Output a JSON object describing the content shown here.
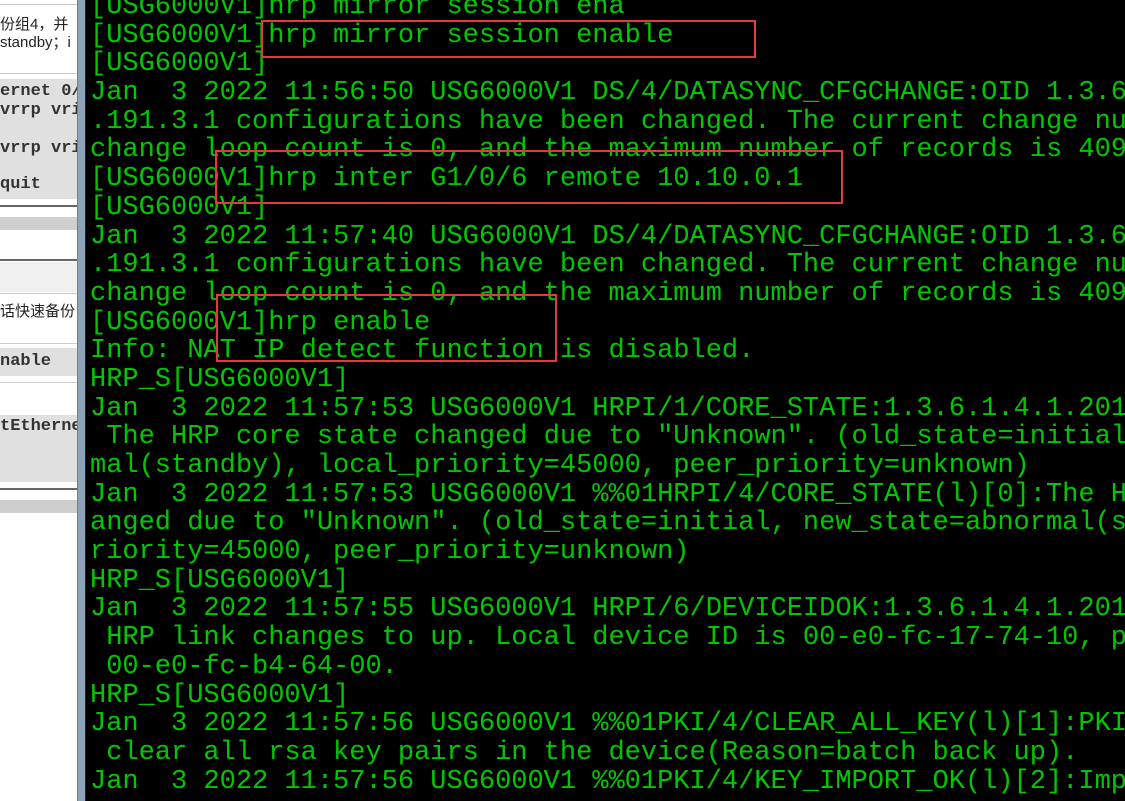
{
  "left_panel": {
    "text_lines": [
      "份组4，并",
      "standby；i",
      "话快速备份"
    ],
    "code_lines": [
      "ernet 0/",
      "vrrp vri",
      "vrrp vri",
      "quit",
      "nable",
      "tEtherne"
    ]
  },
  "terminal": {
    "text_color": "#00c800",
    "highlight_color": "#e8383d",
    "lines": [
      "[USG6000V1]hrp mirror session ena",
      "[USG6000V1]hrp mirror session enable",
      "[USG6000V1]",
      "Jan  3 2022 11:56:50 USG6000V1 DS/4/DATASYNC_CFGCHANGE:OID 1.3.6",
      ".191.3.1 configurations have been changed. The current change nu",
      "change loop count is 0, and the maximum number of records is 409",
      "[USG6000V1]hrp inter G1/0/6 remote 10.10.0.1",
      "[USG6000V1]",
      "Jan  3 2022 11:57:40 USG6000V1 DS/4/DATASYNC_CFGCHANGE:OID 1.3.6",
      ".191.3.1 configurations have been changed. The current change nu",
      "change loop count is 0, and the maximum number of records is 409",
      "[USG6000V1]hrp enable",
      "Info: NAT IP detect function is disabled.",
      "HRP_S[USG6000V1]",
      "Jan  3 2022 11:57:53 USG6000V1 HRPI/1/CORE_STATE:1.3.6.1.4.1.201",
      " The HRP core state changed due to \"Unknown\". (old_state=initial",
      "mal(standby), local_priority=45000, peer_priority=unknown)",
      "Jan  3 2022 11:57:53 USG6000V1 %%01HRPI/4/CORE_STATE(l)[0]:The H",
      "anged due to \"Unknown\". (old_state=initial, new_state=abnormal(s",
      "riority=45000, peer_priority=unknown)",
      "HRP_S[USG6000V1]",
      "Jan  3 2022 11:57:55 USG6000V1 HRPI/6/DEVICEIDOK:1.3.6.1.4.1.201",
      " HRP link changes to up. Local device ID is 00-e0-fc-17-74-10, p",
      " 00-e0-fc-b4-64-00.",
      "HRP_S[USG6000V1]",
      "Jan  3 2022 11:57:56 USG6000V1 %%01PKI/4/CLEAR_ALL_KEY(l)[1]:PKI",
      " clear all rsa key pairs in the device(Reason=batch back up).",
      "Jan  3 2022 11:57:56 USG6000V1 %%01PKI/4/KEY_IMPORT_OK(l)[2]:Imp"
    ]
  }
}
